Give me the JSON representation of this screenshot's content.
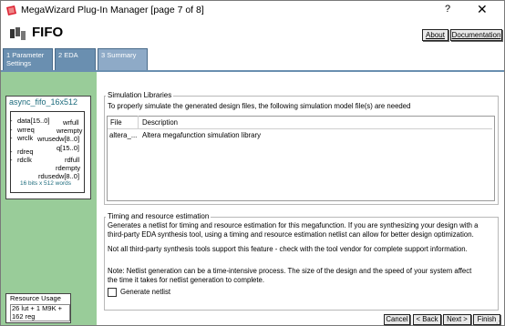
{
  "window": {
    "title": "MegaWizard Plug-In Manager [page 7 of 8]",
    "help_label": "?",
    "close_label": "✕"
  },
  "header": {
    "title": "FIFO",
    "about_label": "About",
    "documentation_label": "Documentation"
  },
  "tabs": [
    {
      "number": "1",
      "label_line1": "Parameter",
      "label_line2": "Settings"
    },
    {
      "number": "2",
      "label_line1": "EDA",
      "label_line2": ""
    },
    {
      "number": "3",
      "label_line1": "Summary",
      "label_line2": ""
    }
  ],
  "symbol": {
    "name": "async_fifo_16x512",
    "ports_left": [
      "data[15..0]",
      "wrreq",
      "wrclk",
      "rdreq",
      "rdclk"
    ],
    "ports_right": [
      "wrfull",
      "wrempty",
      "wrusedw[8..0]",
      "q[15..0]",
      "rdfull",
      "rdempty",
      "rdusedw[8..0]"
    ],
    "footer": "16 bits x 512 words"
  },
  "resource": {
    "title": "Resource Usage",
    "value_line1": "26 lut + 1 M9K +",
    "value_line2": "162 reg"
  },
  "simulation": {
    "group_label": "Simulation Libraries",
    "description": "To properly simulate the generated design files, the following simulation model file(s) are needed",
    "columns": [
      "File",
      "Description"
    ],
    "rows": [
      {
        "file": "altera_...",
        "description": "Altera megafunction simulation library"
      }
    ]
  },
  "timing": {
    "group_label": "Timing and resource estimation",
    "para1_line1": "Generates a netlist for timing and resource estimation for this megafunction. If you are synthesizing your design with a",
    "para1_line2": "third-party EDA synthesis tool, using a timing and resource estimation netlist can allow for better design optimization.",
    "para2": "Not all third-party synthesis tools support this feature - check with the tool vendor for complete support information.",
    "para3_line1": "Note: Netlist generation can be a time-intensive process. The size of the design and the speed of your system affect",
    "para3_line2": "the time it takes for netlist generation to complete.",
    "checkbox_label": "Generate netlist",
    "checkbox_checked": false
  },
  "footer": {
    "cancel_label": "Cancel",
    "back_label": "< Back",
    "next_label": "Next >",
    "finish_label": "Finish"
  }
}
